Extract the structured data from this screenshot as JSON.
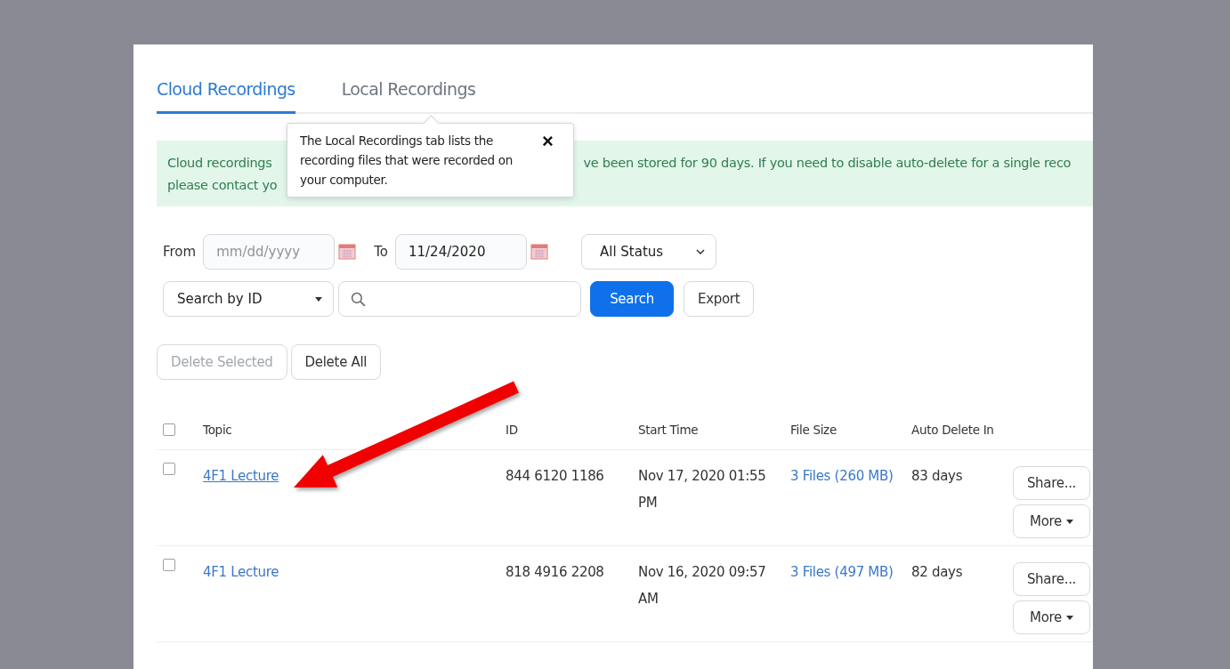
{
  "tabs": [
    {
      "label": "Cloud Recordings",
      "selected": true
    },
    {
      "label": "Local Recordings",
      "selected": false
    }
  ],
  "tooltip": {
    "text": "The Local Recordings tab lists the recording files that were recorded on your computer.",
    "close": "×"
  },
  "banner": {
    "line1_start": "Cloud recordings",
    "line1_end": "ve been stored for 90 days. If you need to disable auto-delete for a single reco",
    "line2_start": "please contact yo"
  },
  "filters": {
    "from_label": "From",
    "from_placeholder": "mm/dd/yyyy",
    "to_label": "To",
    "to_value": "11/24/2020",
    "status": "All Status"
  },
  "search": {
    "type": "Search by ID",
    "button": "Search",
    "export": "Export"
  },
  "actions": [
    {
      "label": "Delete Selected",
      "disabled": true
    },
    {
      "label": "Delete All",
      "disabled": false
    }
  ],
  "table": {
    "select_all_checked": false,
    "columns": [
      "Topic",
      "ID",
      "Start Time",
      "File Size",
      "Auto Delete In"
    ],
    "rows": [
      {
        "checked": false,
        "topic": "4F1 Lecture",
        "hovered": true,
        "id": "844 6120 1186",
        "start": "Nov 17, 2020 01:55 PM",
        "files": "3 Files (260 MB)",
        "auto_delete": "83 days",
        "share": "Share...",
        "more": "More"
      },
      {
        "checked": false,
        "topic": "4F1 Lecture",
        "hovered": false,
        "id": "818 4916 2208",
        "start": "Nov 16, 2020 09:57 AM",
        "files": "3 Files (497 MB)",
        "auto_delete": "82 days",
        "share": "Share...",
        "more": "More"
      }
    ]
  }
}
